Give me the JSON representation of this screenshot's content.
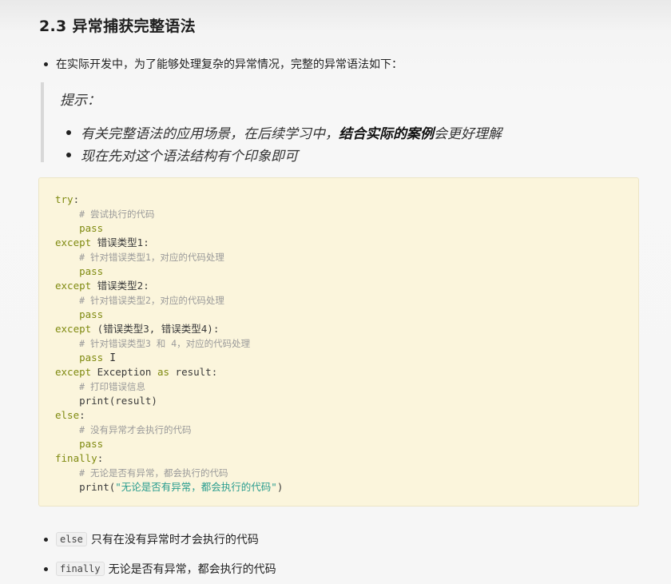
{
  "section": {
    "title": "2.3 异常捕获完整语法"
  },
  "intro": {
    "text": "在实际开发中，为了能够处理复杂的异常情况，完整的异常语法如下："
  },
  "tip": {
    "title": "提示：",
    "item1_pre": "有关完整语法的应用场景，在后续学习中，",
    "item1_bold": "结合实际的案例",
    "item1_post": "会更好理解",
    "item2": "现在先对这个语法结构有个印象即可"
  },
  "code": {
    "lines": [
      {
        "kw": "try",
        "rest": ":"
      },
      {
        "indent": "    ",
        "comment": "# 尝试执行的代码"
      },
      {
        "indent": "    ",
        "kw": "pass"
      },
      {
        "kw": "except",
        "rest": " 错误类型1:"
      },
      {
        "indent": "    ",
        "comment": "# 针对错误类型1，对应的代码处理"
      },
      {
        "indent": "    ",
        "kw": "pass"
      },
      {
        "kw": "except",
        "rest": " 错误类型2:"
      },
      {
        "indent": "    ",
        "comment": "# 针对错误类型2，对应的代码处理"
      },
      {
        "indent": "    ",
        "kw": "pass"
      },
      {
        "kw": "except",
        "rest": " (错误类型3, 错误类型4):"
      },
      {
        "indent": "    ",
        "comment": "# 针对错误类型3 和 4，对应的代码处理"
      },
      {
        "indent": "    ",
        "kw": "pass",
        "cursor": "I"
      },
      {
        "kw": "except",
        "rest": " Exception ",
        "kw2": "as",
        "rest2": " result:"
      },
      {
        "indent": "    ",
        "comment": "# 打印错误信息"
      },
      {
        "indent": "    ",
        "rest": "print(result)"
      },
      {
        "kw": "else",
        "rest": ":"
      },
      {
        "indent": "    ",
        "comment": "# 没有异常才会执行的代码"
      },
      {
        "indent": "    ",
        "kw": "pass"
      },
      {
        "kw": "finally",
        "rest": ":"
      },
      {
        "indent": "    ",
        "comment": "# 无论是否有异常，都会执行的代码"
      },
      {
        "indent": "    ",
        "rest": "print(",
        "str": "\"无论是否有异常，都会执行的代码\"",
        "rest2": ")"
      }
    ]
  },
  "notes": [
    {
      "code": "else",
      "text": "只有在没有异常时才会执行的代码"
    },
    {
      "code": "finally",
      "text": "无论是否有异常，都会执行的代码"
    }
  ]
}
